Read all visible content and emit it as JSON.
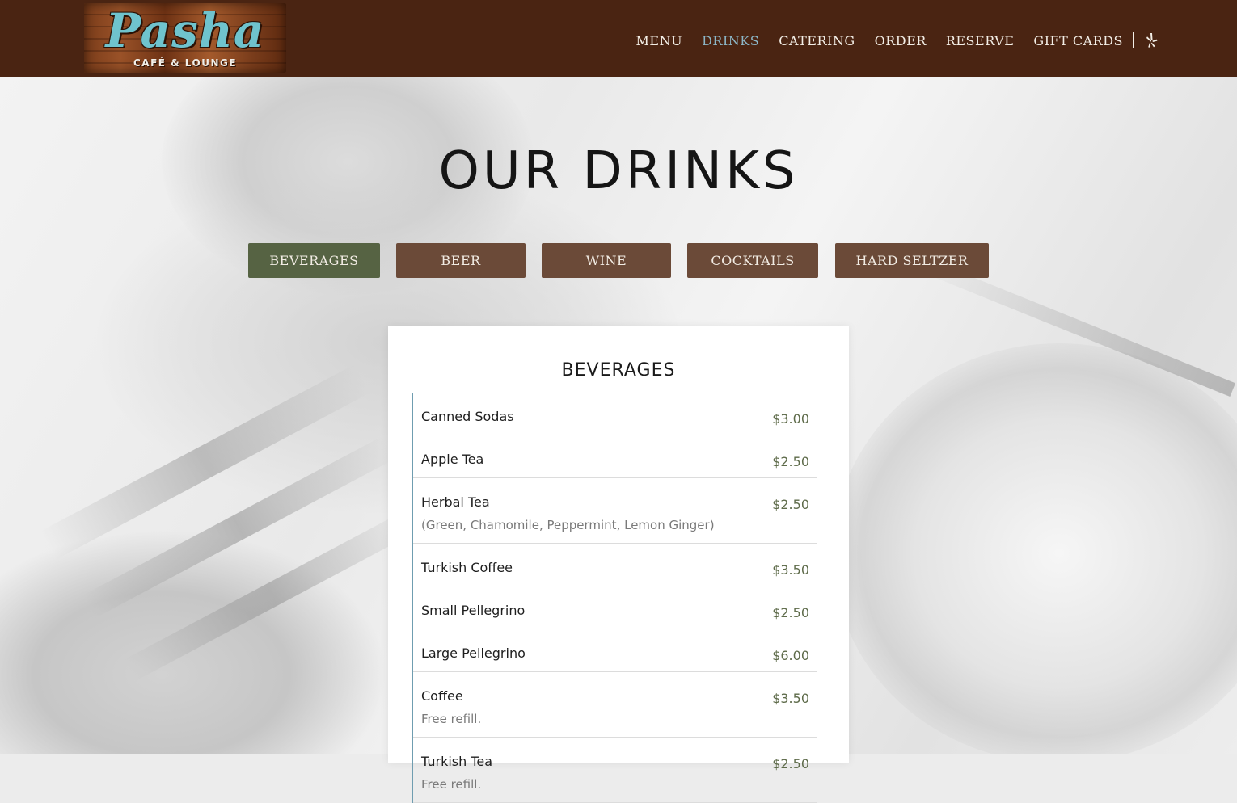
{
  "header": {
    "logo": {
      "name": "Pasha",
      "tagline": "CAFÉ & LOUNGE"
    },
    "nav": [
      {
        "label": "MENU",
        "active": false
      },
      {
        "label": "DRINKS",
        "active": true
      },
      {
        "label": "CATERING",
        "active": false
      },
      {
        "label": "ORDER",
        "active": false
      },
      {
        "label": "RESERVE",
        "active": false
      },
      {
        "label": "GIFT CARDS",
        "active": false
      }
    ],
    "social_icon": "yelp-icon"
  },
  "main": {
    "title": "OUR DRINKS",
    "tabs": [
      {
        "label": "BEVERAGES",
        "active": true
      },
      {
        "label": "BEER",
        "active": false
      },
      {
        "label": "WINE",
        "active": false
      },
      {
        "label": "COCKTAILS",
        "active": false
      },
      {
        "label": "HARD SELTZER",
        "active": false
      }
    ],
    "section": {
      "title": "BEVERAGES",
      "items": [
        {
          "name": "Canned Sodas",
          "price": "$3.00",
          "description": ""
        },
        {
          "name": "Apple Tea",
          "price": "$2.50",
          "description": ""
        },
        {
          "name": "Herbal Tea",
          "price": "$2.50",
          "description": "(Green, Chamomile, Peppermint, Lemon Ginger)"
        },
        {
          "name": "Turkish Coffee",
          "price": "$3.50",
          "description": ""
        },
        {
          "name": "Small Pellegrino",
          "price": "$2.50",
          "description": ""
        },
        {
          "name": "Large Pellegrino",
          "price": "$6.00",
          "description": ""
        },
        {
          "name": "Coffee",
          "price": "$3.50",
          "description": "Free refill."
        },
        {
          "name": "Turkish Tea",
          "price": "$2.50",
          "description": "Free refill."
        }
      ]
    }
  },
  "colors": {
    "header_bg": "#4a2412",
    "nav_active": "#8cb6c6",
    "tab_default": "#6b4a38",
    "tab_active": "#566343",
    "price": "#5e6b4a",
    "list_rule": "#6f9db0"
  }
}
